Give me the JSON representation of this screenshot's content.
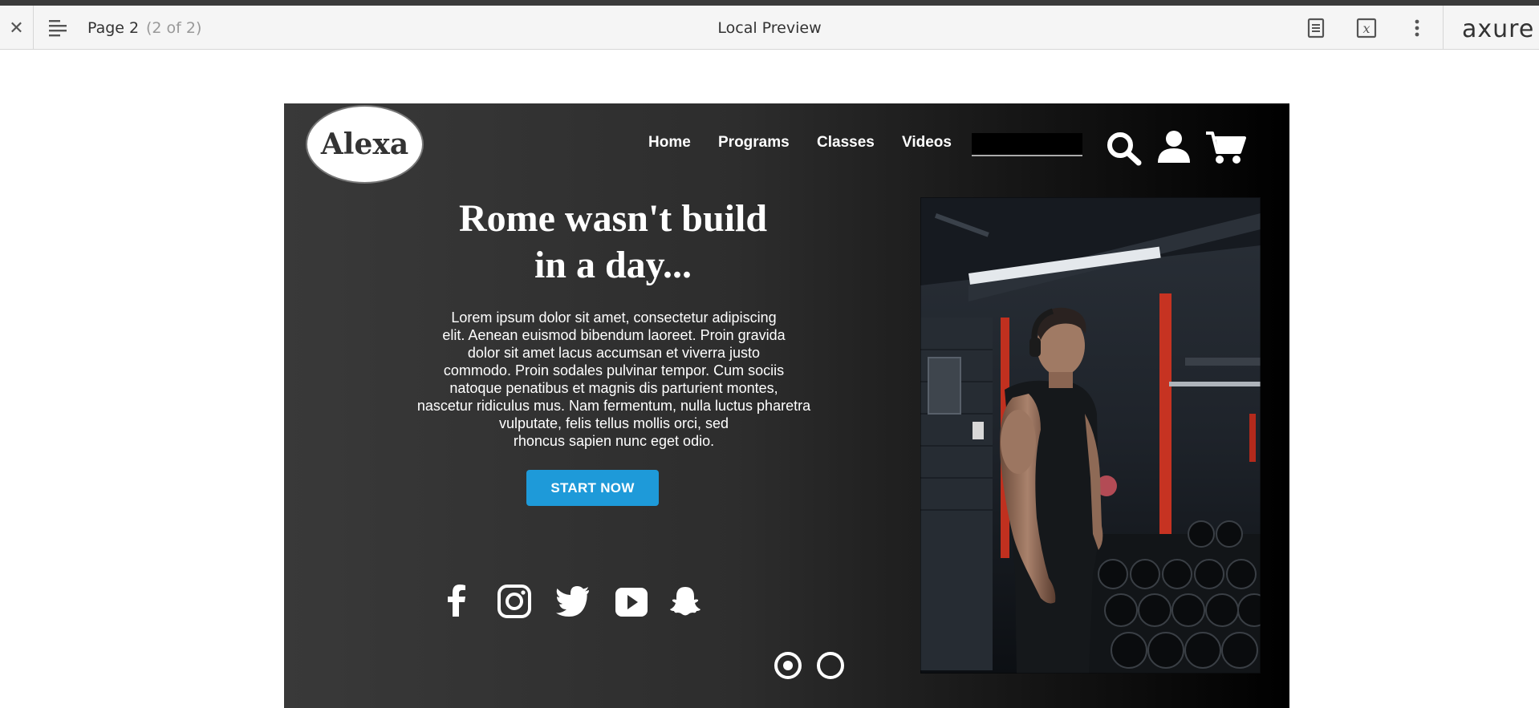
{
  "preview": {
    "close_glyph": "✕",
    "page_label": "Page 2",
    "page_count": "(2 of 2)",
    "title": "Local Preview",
    "brand": "axure",
    "icons": [
      "close-icon",
      "menu-icon",
      "notes-icon",
      "variables-icon",
      "more-options-icon"
    ]
  },
  "site": {
    "logo": "Alexa",
    "nav": [
      "Home",
      "Programs",
      "Classes",
      "Videos"
    ],
    "search_value": "",
    "header_icons": [
      "search-icon",
      "user-icon",
      "cart-icon"
    ]
  },
  "hero": {
    "headline_line1": "Rome wasn't build",
    "headline_line2": "in a day...",
    "body_lines": [
      "Lorem ipsum dolor sit amet, consectetur adipiscing",
      "elit. Aenean euismod bibendum laoreet. Proin gravida",
      "dolor sit amet lacus accumsan et viverra justo",
      "commodo. Proin sodales pulvinar tempor. Cum sociis",
      "natoque penatibus et magnis dis parturient montes,",
      "nascetur ridiculus mus. Nam fermentum, nulla luctus pharetra",
      "vulputate, felis tellus mollis orci, sed",
      "rhoncus sapien nunc eget odio."
    ],
    "cta_label": "START NOW",
    "cta_color": "#1e9ad9"
  },
  "social_icons": [
    "facebook-icon",
    "instagram-icon",
    "twitter-icon",
    "youtube-icon",
    "snapchat-icon"
  ],
  "carousel": {
    "slide_count": 2,
    "active_index": 0
  },
  "image": {
    "subject": "gym-athlete-photo"
  }
}
